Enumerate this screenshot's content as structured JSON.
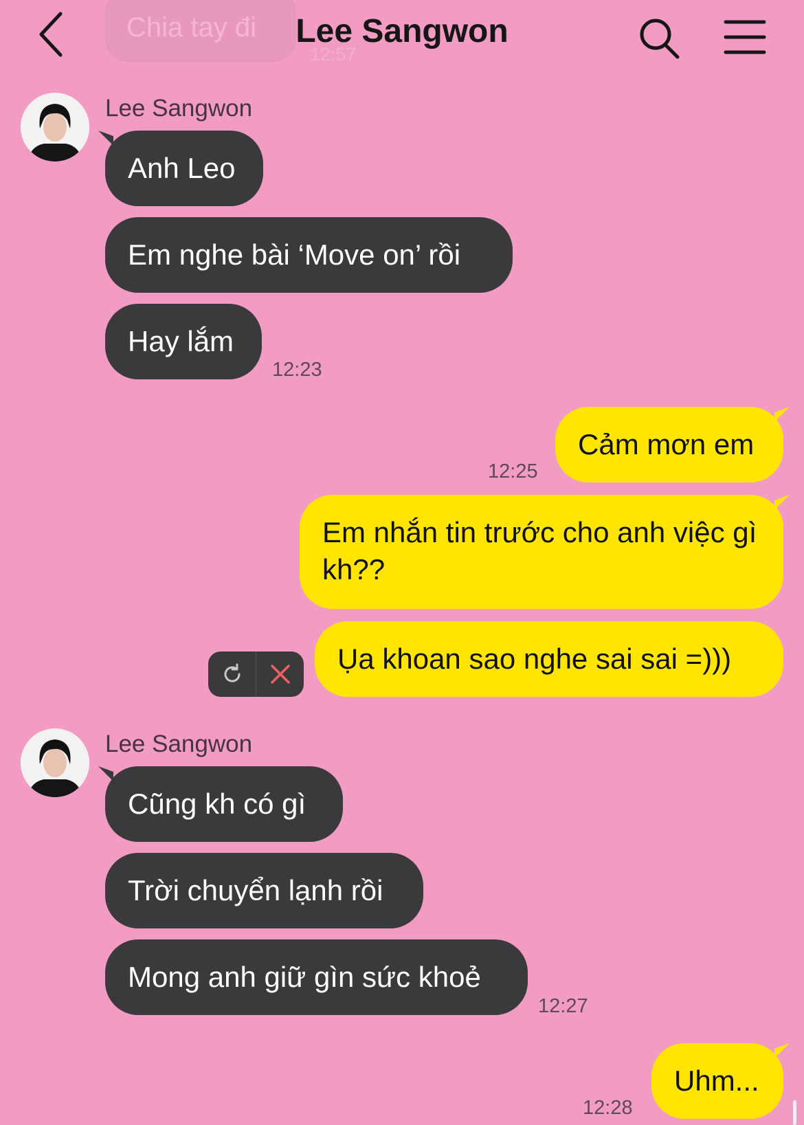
{
  "header": {
    "title": "Lee Sangwon",
    "faded_message": "Chia tay đi",
    "faded_time": "12:57"
  },
  "colors": {
    "background": "#f29bc3",
    "incoming_bubble": "#3a393b",
    "outgoing_bubble": "#ffe500"
  },
  "icons": {
    "back": "chevron-left-icon",
    "search": "search-icon",
    "menu": "hamburger-menu-icon",
    "retry": "refresh-icon",
    "cancel": "close-icon"
  },
  "group1": {
    "sender": "Lee Sangwon",
    "messages": [
      "Anh Leo",
      "Em nghe bài ‘Move on’ rồi",
      "Hay lắm"
    ],
    "time": "12:23"
  },
  "outgoing1": {
    "message": "Cảm mơn em",
    "time": "12:25"
  },
  "outgoing2": {
    "message": "Em nhắn tin trước cho anh việc gì kh??"
  },
  "outgoing3": {
    "message": "Ụa khoan sao nghe sai sai =)))"
  },
  "group2": {
    "sender": "Lee Sangwon",
    "messages": [
      "Cũng kh có gì",
      "Trời chuyển lạnh rồi",
      "Mong anh giữ gìn sức khoẻ"
    ],
    "time": "12:27"
  },
  "outgoing4": {
    "message": "Uhm...",
    "time": "12:28"
  }
}
